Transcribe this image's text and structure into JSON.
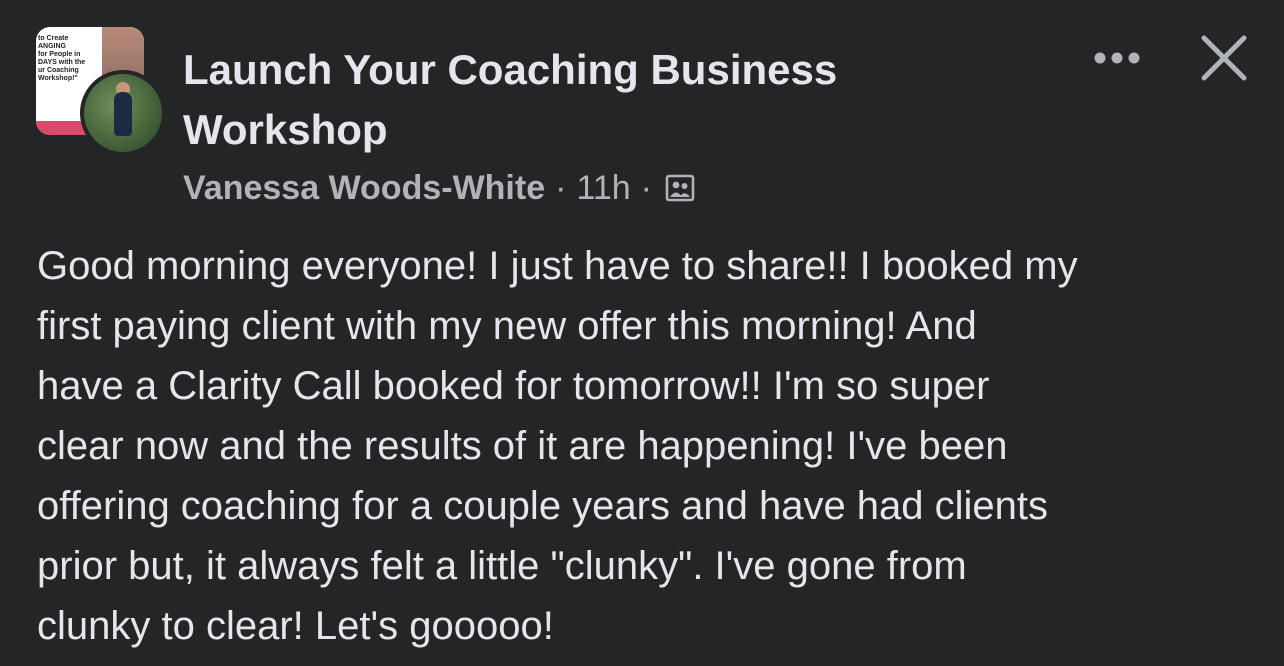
{
  "post": {
    "group_name": "Launch Your Coaching Business Workshop",
    "author": "Vanessa Woods-White",
    "time_ago": "11h",
    "separator": "·",
    "body": "Good morning everyone!  I just have to share!! I booked my\nfirst paying client with my new offer this morning!  And\nhave a Clarity Call booked for tomorrow!! I'm so super\nclear now and the results of it are happening!  I've been\noffering coaching for a couple years  and have had clients\nprior but, it always felt a little \"clunky\".  I've gone from\nclunky to clear!  Let's gooooo!"
  },
  "group_avatar": {
    "thumbnail_text": "to Create\nANGING\nfor People in\nDAYS with the\nur Coaching\nWorkshop!\""
  },
  "icons": {
    "more": "more-horizontal-icon",
    "close": "close-icon",
    "audience": "group-audience-icon"
  },
  "colors": {
    "background": "#242526",
    "primary_text": "#e4e6eb",
    "secondary_text": "#b0b3b8"
  }
}
